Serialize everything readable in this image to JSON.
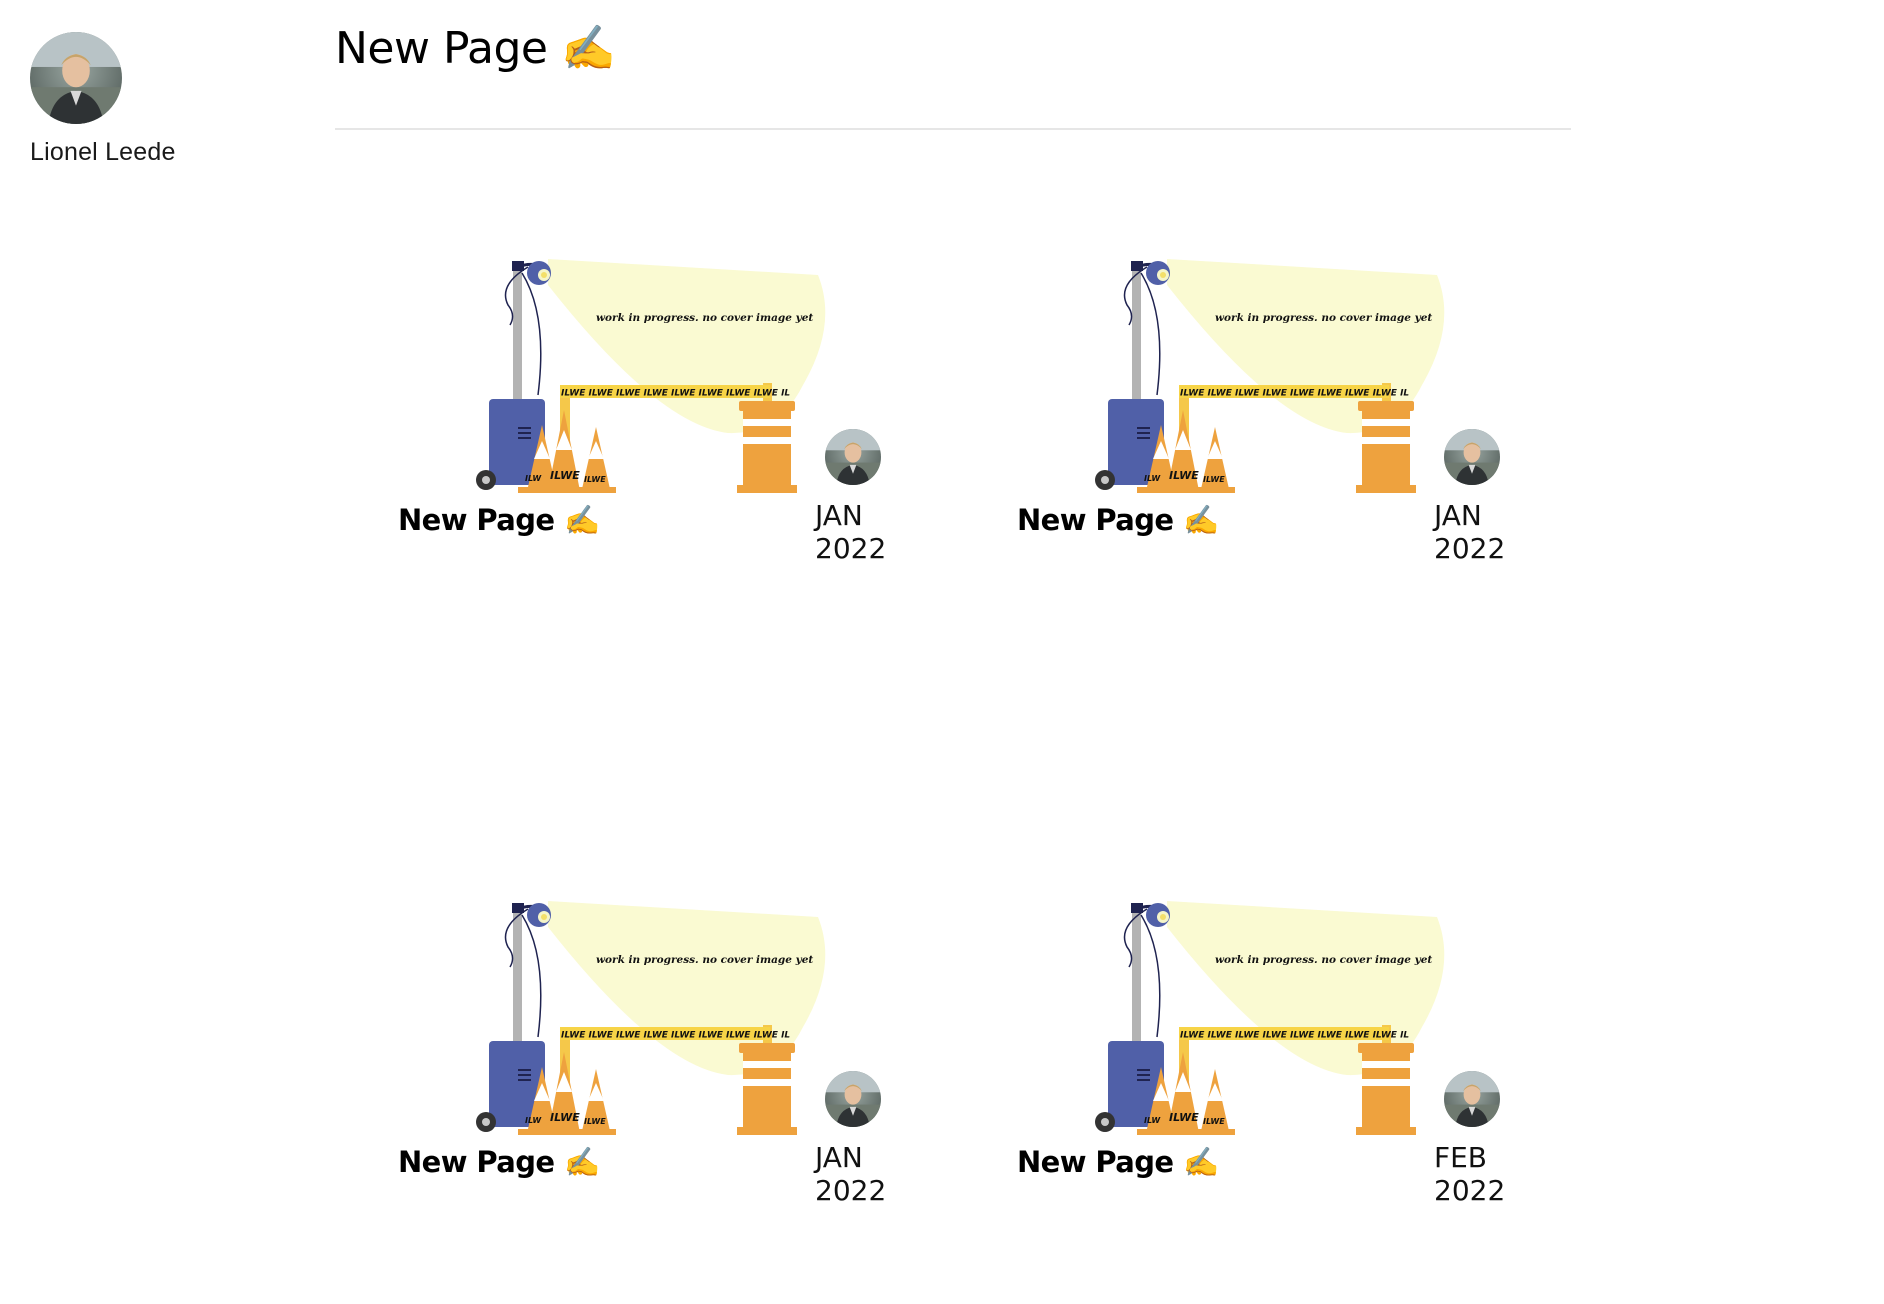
{
  "profile": {
    "name": "Lionel Leede"
  },
  "header": {
    "title": "New Page ✍️"
  },
  "cover_image": {
    "caption": "work in progress. no cover image yet",
    "tape_text": "ILWE ILWE ILWE ILWE ILWE ILWE ILWE ILWE IL",
    "cone_labels": [
      "ILW",
      "ILWE",
      "ILWE"
    ]
  },
  "cards": [
    {
      "title": "New Page ✍️",
      "month": "JAN",
      "year": "2022"
    },
    {
      "title": "New Page ✍️",
      "month": "JAN",
      "year": "2022"
    },
    {
      "title": "New Page ✍️",
      "month": "JAN",
      "year": "2022"
    },
    {
      "title": "New Page ✍️",
      "month": "FEB",
      "year": "2022"
    }
  ],
  "colors": {
    "lamp_blue": "#5060a8",
    "light_beam": "#fafad2",
    "construction_orange": "#eea23e",
    "tape_yellow": "#f7d447"
  }
}
